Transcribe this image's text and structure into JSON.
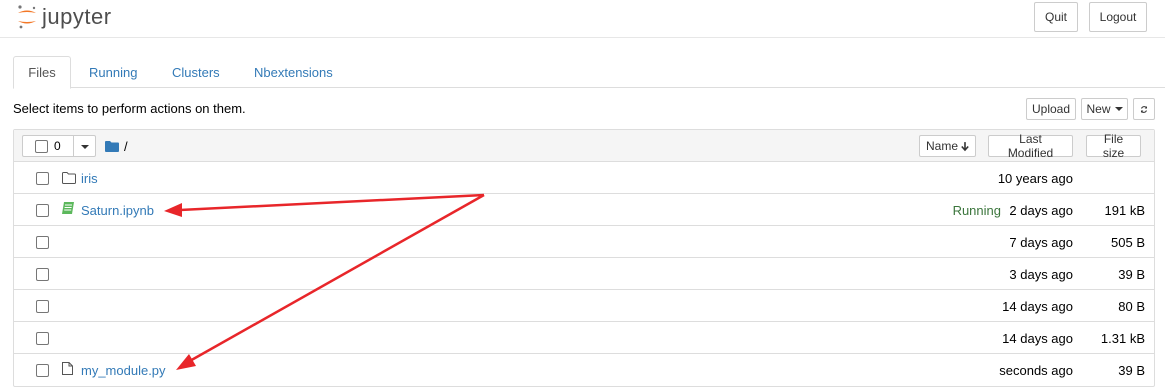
{
  "header": {
    "logo_text": "jupyter",
    "quit_label": "Quit",
    "logout_label": "Logout"
  },
  "tabs": [
    {
      "label": "Files",
      "active": true
    },
    {
      "label": "Running",
      "active": false
    },
    {
      "label": "Clusters",
      "active": false
    },
    {
      "label": "Nbextensions",
      "active": false
    }
  ],
  "toolbar": {
    "instructions": "Select items to perform actions on them.",
    "upload_label": "Upload",
    "new_label": "New",
    "refresh_icon": "refresh-icon"
  },
  "list_header": {
    "selected_count": "0",
    "path": "/",
    "sort_name_label": "Name",
    "sort_modified_label": "Last Modified",
    "sort_size_label": "File size"
  },
  "rows": [
    {
      "icon": "folder-icon",
      "name": "iris",
      "status": "",
      "modified": "10 years ago",
      "size": ""
    },
    {
      "icon": "notebook-icon",
      "name": "Saturn.ipynb",
      "status": "Running",
      "modified": "2 days ago",
      "size": "191 kB"
    },
    {
      "icon": "",
      "name": "",
      "status": "",
      "modified": "7 days ago",
      "size": "505 B"
    },
    {
      "icon": "",
      "name": "",
      "status": "",
      "modified": "3 days ago",
      "size": "39 B"
    },
    {
      "icon": "",
      "name": "",
      "status": "",
      "modified": "14 days ago",
      "size": "80 B"
    },
    {
      "icon": "",
      "name": "",
      "status": "",
      "modified": "14 days ago",
      "size": "1.31 kB"
    },
    {
      "icon": "file-icon",
      "name": "my_module.py",
      "status": "",
      "modified": "seconds ago",
      "size": "39 B"
    }
  ],
  "colors": {
    "link": "#337ab7",
    "running": "#3c763d",
    "annotation_arrow": "#e8262a",
    "logo_orange": "#f37726"
  }
}
